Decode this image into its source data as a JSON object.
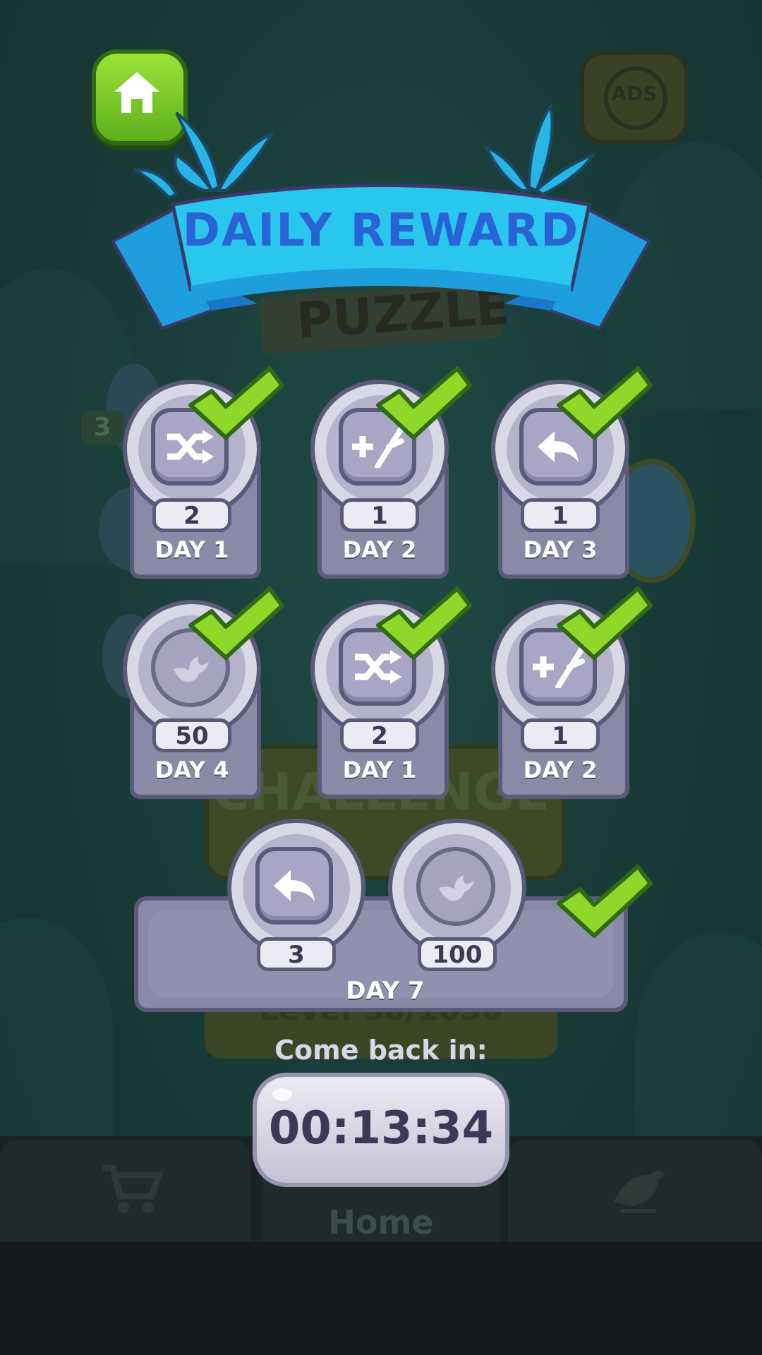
{
  "header": {
    "title": "DAILY REWARD",
    "home_icon": "home-icon",
    "ads_label": "ADS"
  },
  "background": {
    "sign_text": "PUZZLE",
    "challenge_text": "CHALLENGE",
    "level_text": "Level 50/1050",
    "side_counter": "3",
    "home_tab_label": "Home"
  },
  "rewards": [
    {
      "day": "DAY 1",
      "count": "2",
      "icon": "shuffle-icon",
      "claimed": true
    },
    {
      "day": "DAY 2",
      "count": "1",
      "icon": "branch-plus-icon",
      "claimed": true
    },
    {
      "day": "DAY 3",
      "count": "1",
      "icon": "undo-icon",
      "claimed": true
    },
    {
      "day": "DAY 4",
      "count": "50",
      "icon": "bird-coin-icon",
      "claimed": true
    },
    {
      "day": "DAY 1",
      "count": "2",
      "icon": "shuffle-icon",
      "claimed": true
    },
    {
      "day": "DAY 2",
      "count": "1",
      "icon": "branch-plus-icon",
      "claimed": true
    }
  ],
  "day7": {
    "label": "DAY 7",
    "items": [
      {
        "count": "3",
        "icon": "undo-icon"
      },
      {
        "count": "100",
        "icon": "bird-coin-icon"
      }
    ],
    "claimed": true
  },
  "timer": {
    "label": "Come back in:",
    "value": "00:13:34"
  },
  "colors": {
    "ribbon": "#29c6ee",
    "ribbon_text": "#2a64d4",
    "check": "#8fd82a",
    "tile": "#8a8aa6",
    "home_button": "#7ccb2b"
  }
}
